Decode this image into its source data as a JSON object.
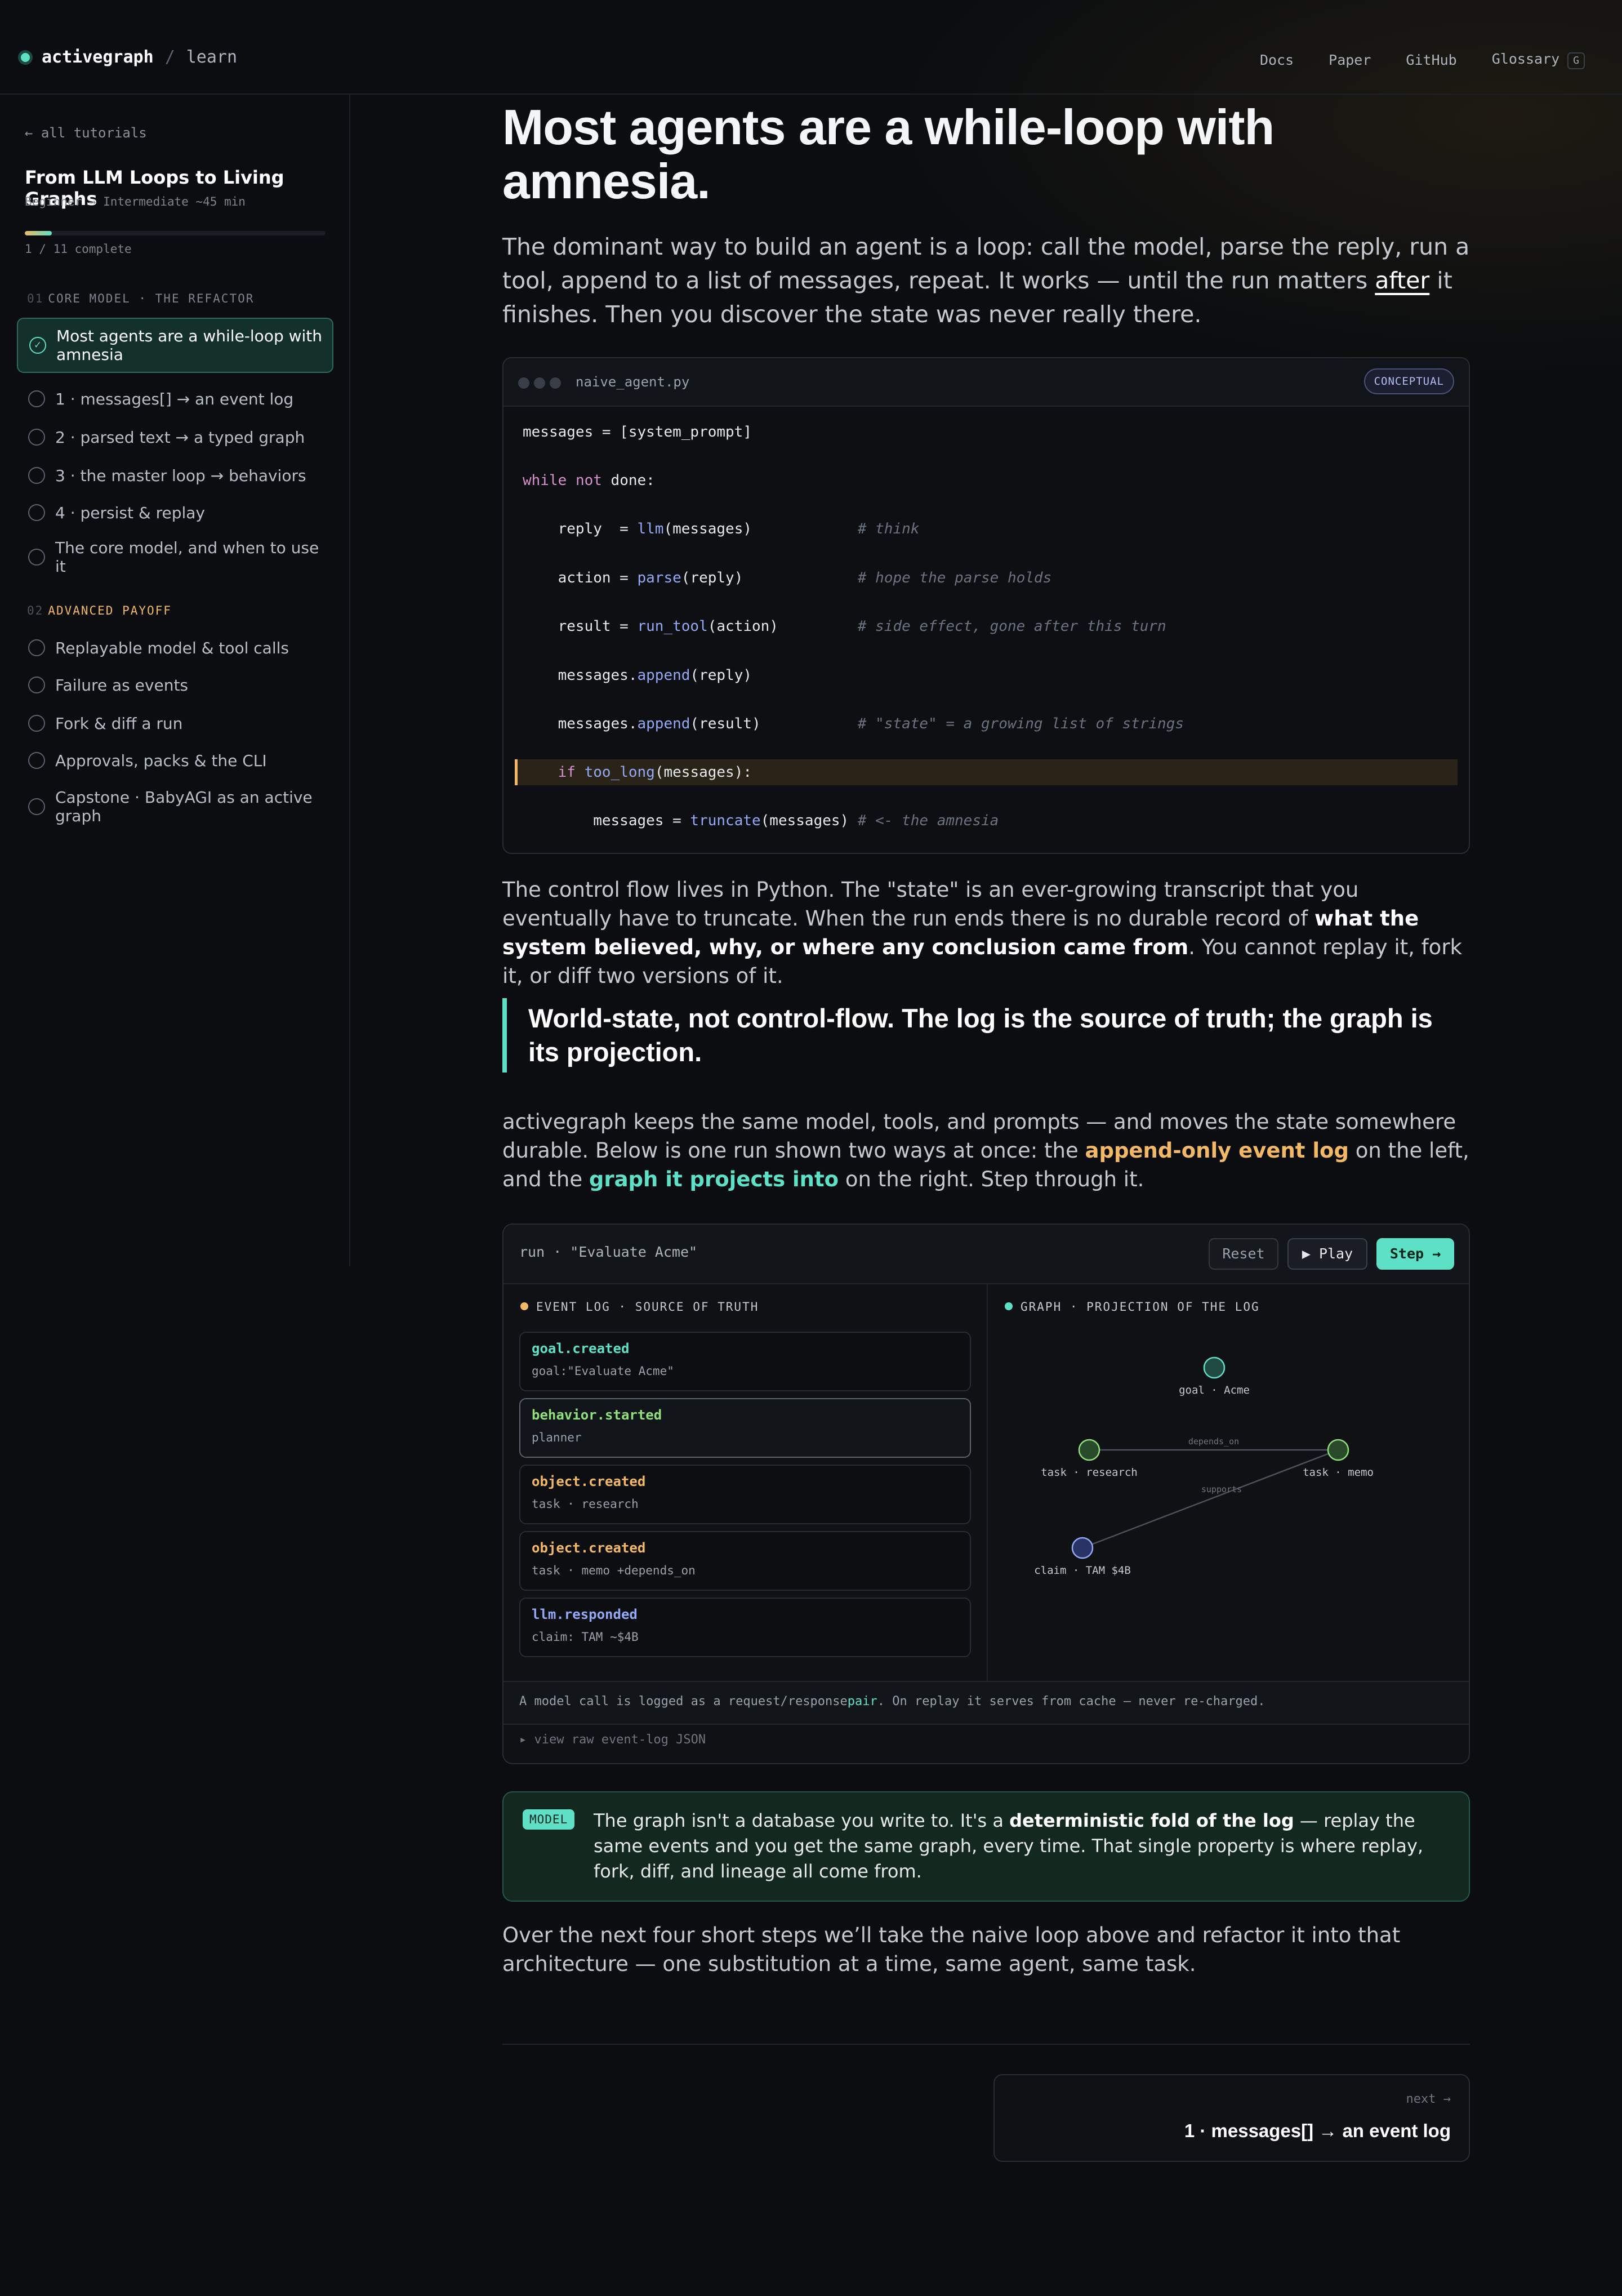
{
  "header": {
    "brand": "activegraph",
    "separator": "/",
    "section": "learn",
    "nav": [
      {
        "label": "Docs"
      },
      {
        "label": "Paper"
      },
      {
        "label": "GitHub"
      },
      {
        "label": "Glossary",
        "kbd": "G"
      }
    ]
  },
  "sidebar": {
    "back_link": "← all tutorials",
    "tutorial_title": "From LLM Loops to Living Graphs",
    "meta": "Beginner → Intermediate  ~45 min",
    "progress_text": "1 / 11 complete",
    "progress_fraction": 0.09,
    "sections": [
      {
        "num": "01",
        "title": "CORE MODEL · THE REFACTOR",
        "items": [
          {
            "label": "Most agents are a while-loop with amnesia",
            "active": true,
            "done": true
          },
          {
            "label": "1 · messages[] → an event log"
          },
          {
            "label": "2 · parsed text → a typed graph"
          },
          {
            "label": "3 · the master loop → behaviors"
          },
          {
            "label": "4 · persist & replay"
          },
          {
            "label": "The core model, and when to use it"
          }
        ]
      },
      {
        "num": "02",
        "title": "ADVANCED PAYOFF",
        "items": [
          {
            "label": "Replayable model & tool calls"
          },
          {
            "label": "Failure as events"
          },
          {
            "label": "Fork & diff a run"
          },
          {
            "label": "Approvals, packs & the CLI"
          },
          {
            "label": "Capstone · BabyAGI as an active graph"
          }
        ]
      }
    ]
  },
  "main": {
    "title": "Most agents are a while-loop with amnesia.",
    "lead": {
      "before": "The dominant way to build an agent is a loop: call the model, parse the reply, run a tool, append to a list of messages, repeat. It works — until the run matters ",
      "underline": "after",
      "after": " it finishes. Then you discover the state was never really there."
    },
    "code": {
      "filename": "naive_agent.py",
      "badge": "CONCEPTUAL"
    },
    "para2": {
      "before": "The control flow lives in Python. The \"state\" is an ever-growing transcript that you eventually have to truncate. When the run ends there is no durable record of ",
      "bold": "what the system believed, why, or where any conclusion came from",
      "after": ". You cannot replay it, fork it, or diff two versions of it."
    },
    "quote": "World-state, not control-flow. The log is the source of truth; the graph is its projection.",
    "para3": {
      "before": "activegraph keeps the same model, tools, and prompts — and moves the state somewhere durable. Below is one run shown two ways at once: the ",
      "amber": "append-only event log",
      "middle": " on the left, and the ",
      "teal": "graph it projects into",
      "after": " on the right. Step through it."
    },
    "run": {
      "title": "run · \"Evaluate Acme\"",
      "reset_label": "Reset",
      "play_label": "▶ Play",
      "step_label": "Step →",
      "log_label": "EVENT LOG · SOURCE OF TRUTH",
      "graph_label": "GRAPH · PROJECTION OF THE LOG",
      "events": [
        {
          "type": "goal.created",
          "payload": "goal:\"Evaluate Acme\"",
          "color": "#5ee0c6"
        },
        {
          "type": "behavior.started",
          "payload": "planner",
          "color": "#8fe07a",
          "current": true
        },
        {
          "type": "object.created",
          "payload": "task · research",
          "color": "#f2b866"
        },
        {
          "type": "object.created",
          "payload": "task · memo +depends_on",
          "color": "#f2b866"
        },
        {
          "type": "llm.responded",
          "payload": "claim: TAM ~$4B",
          "color": "#93a9f5"
        }
      ],
      "graph": {
        "nodes": [
          {
            "id": "goal",
            "label": "goal · Acme",
            "kind": "goal"
          },
          {
            "id": "research",
            "label": "task · research",
            "kind": "task"
          },
          {
            "id": "memo",
            "label": "task · memo",
            "kind": "task"
          },
          {
            "id": "claim",
            "label": "claim · TAM $4B",
            "kind": "claim"
          }
        ],
        "edges": [
          {
            "from": "research",
            "to": "memo",
            "label": "depends_on"
          },
          {
            "from": "claim",
            "to": "memo",
            "label": "supports"
          }
        ]
      },
      "note_before": "A model call is logged as a request/response",
      "note_teal": "pair",
      "note_after": ". On replay it serves from cache — never re-charged.",
      "raw_toggle": "▸ view raw event-log JSON"
    },
    "model": {
      "chip": "MODEL",
      "before": "The graph isn't a database you write to. It's a ",
      "bold": "deterministic fold of the log",
      "after": " — replay the same events and you get the same graph, every time. That single property is where replay, fork, diff, and lineage all come from."
    },
    "para4": "Over the next four short steps we’ll take the naive loop above and refactor it into that architecture — one substitution at a time, same agent, same task.",
    "next": {
      "label": "next →",
      "title": "1 · messages[] → an event log"
    }
  },
  "colors": {
    "accent_teal": "#5ee0c6",
    "accent_amber": "#f2b866",
    "accent_blue": "#93a9f5",
    "background": "#0b0d10"
  }
}
